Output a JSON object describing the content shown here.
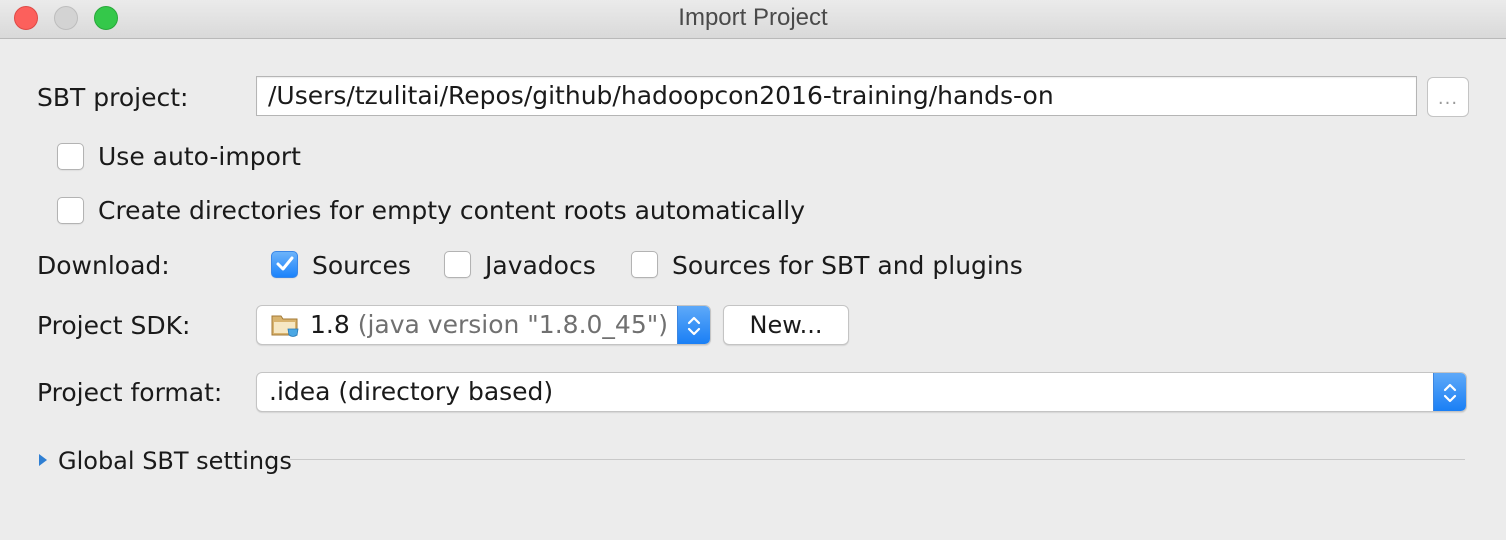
{
  "window": {
    "title": "Import Project"
  },
  "sbt_project": {
    "label": "SBT project:",
    "path": "/Users/tzulitai/Repos/github/hadoopcon2016-training/hands-on",
    "browse_label": "..."
  },
  "options": {
    "auto_import": {
      "label": "Use auto-import",
      "checked": false
    },
    "create_dirs": {
      "label": "Create directories for empty content roots automatically",
      "checked": false
    }
  },
  "download": {
    "label": "Download:",
    "sources": {
      "label": "Sources",
      "checked": true
    },
    "javadocs": {
      "label": "Javadocs",
      "checked": false
    },
    "sbt_sources": {
      "label": "Sources for SBT and plugins",
      "checked": false
    }
  },
  "sdk": {
    "label": "Project SDK:",
    "version": "1.8",
    "detail": "(java version \"1.8.0_45\")",
    "new_button": "New..."
  },
  "format": {
    "label": "Project format:",
    "value": ".idea (directory based)"
  },
  "global_settings": {
    "label": "Global SBT settings"
  },
  "colors": {
    "accent": "#1a82fb",
    "close": "#fc605c",
    "maximize": "#34c84a"
  }
}
